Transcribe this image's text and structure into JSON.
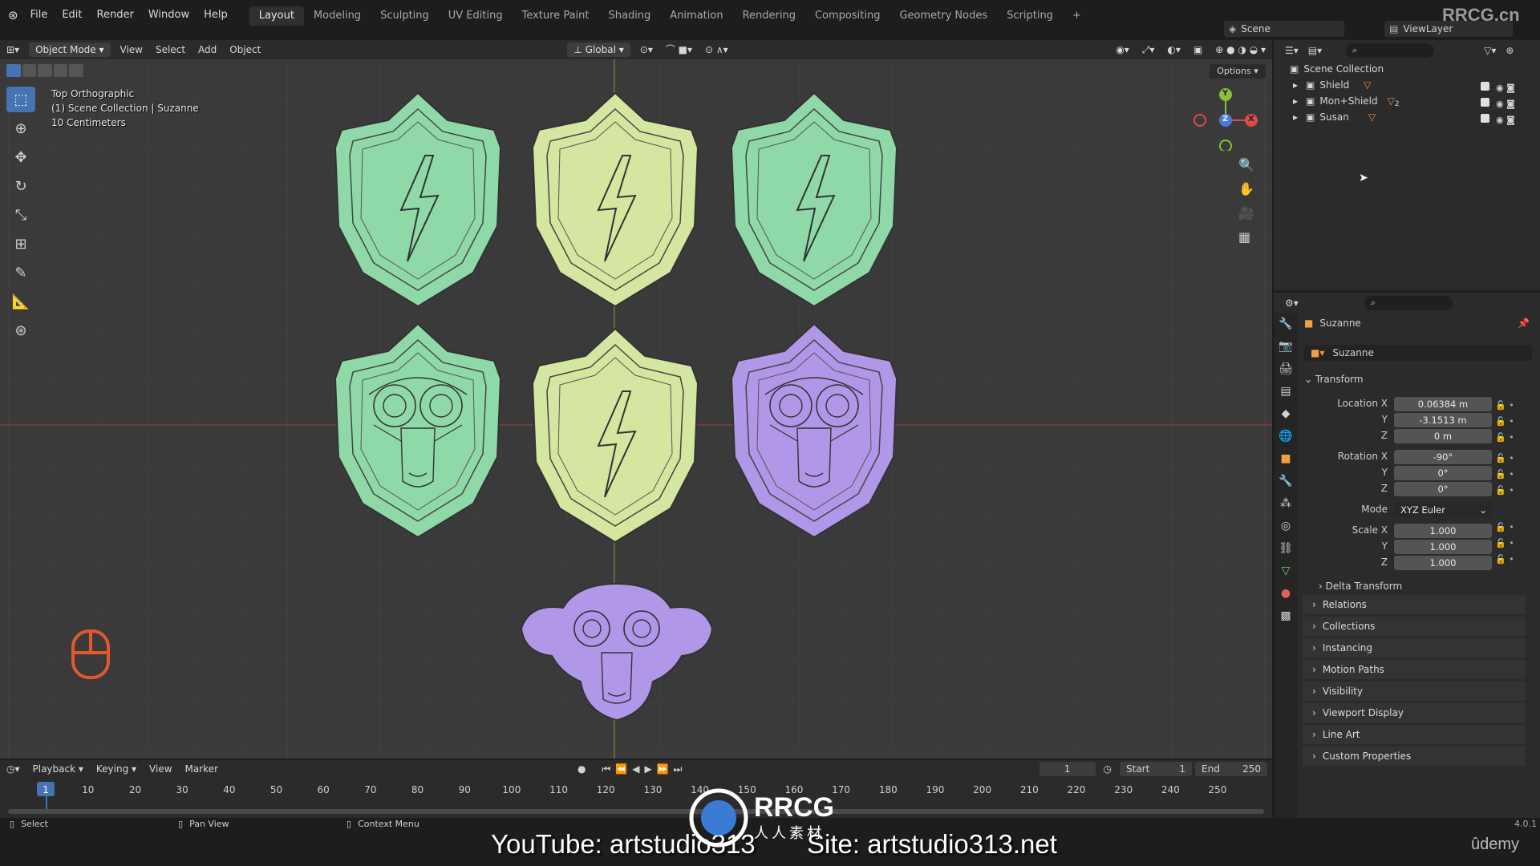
{
  "topbar": {
    "menus": [
      "File",
      "Edit",
      "Render",
      "Window",
      "Help"
    ],
    "workspaces": [
      "Layout",
      "Modeling",
      "Sculpting",
      "UV Editing",
      "Texture Paint",
      "Shading",
      "Animation",
      "Rendering",
      "Compositing",
      "Geometry Nodes",
      "Scripting"
    ],
    "active_workspace": "Layout",
    "scene": "Scene",
    "view_layer": "ViewLayer",
    "watermark": "RRCG.cn"
  },
  "viewport_header": {
    "mode": "Object Mode",
    "menus": [
      "View",
      "Select",
      "Add",
      "Object"
    ],
    "orientation": "Global",
    "options_label": "Options"
  },
  "viewport_overlay": {
    "view_name": "Top Orthographic",
    "collection_info": "(1) Scene Collection | Suzanne",
    "scale": "10 Centimeters"
  },
  "gizmo": {
    "y": "Y",
    "z": "Z",
    "x": "X"
  },
  "outliner": {
    "root": "Scene Collection",
    "items": [
      {
        "name": "Shield",
        "badge": ""
      },
      {
        "name": "Mon+Shield",
        "badge": "2"
      },
      {
        "name": "Susan",
        "badge": ""
      }
    ]
  },
  "properties": {
    "object_name": "Suzanne",
    "datablock_name": "Suzanne",
    "transform_title": "Transform",
    "location_label": "Location X",
    "rotation_label": "Rotation X",
    "mode_label": "Mode",
    "scale_label": "Scale X",
    "y_label": "Y",
    "z_label": "Z",
    "location": [
      "0.06384 m",
      "-3.1513 m",
      "0 m"
    ],
    "rotation": [
      "-90°",
      "0°",
      "0°"
    ],
    "rotation_mode": "XYZ Euler",
    "scale": [
      "1.000",
      "1.000",
      "1.000"
    ],
    "delta": "Delta Transform",
    "panels": [
      "Relations",
      "Collections",
      "Instancing",
      "Motion Paths",
      "Visibility",
      "Viewport Display",
      "Line Art",
      "Custom Properties"
    ]
  },
  "timeline": {
    "menus": [
      "Playback",
      "Keying",
      "View",
      "Marker"
    ],
    "current_frame": "1",
    "start_label": "Start",
    "start": "1",
    "end_label": "End",
    "end": "250",
    "ticks": [
      "1",
      "10",
      "20",
      "30",
      "40",
      "50",
      "60",
      "70",
      "80",
      "90",
      "100",
      "110",
      "120",
      "130",
      "140",
      "150",
      "160",
      "170",
      "180",
      "190",
      "200",
      "210",
      "220",
      "230",
      "240",
      "250"
    ]
  },
  "statusbar": {
    "select": "Select",
    "pan": "Pan View",
    "context": "Context Menu",
    "version": "4.0.1",
    "youtube": "YouTube: artstudio313",
    "site": "Site: artstudio313.net",
    "udemy": "ûdemy",
    "logo_text": "RRCG",
    "logo_sub": "人人素材"
  },
  "colors": {
    "green": "#8fd9a8",
    "yellow": "#d5e6a0",
    "purple": "#b197e8",
    "accent": "#4772b3"
  }
}
